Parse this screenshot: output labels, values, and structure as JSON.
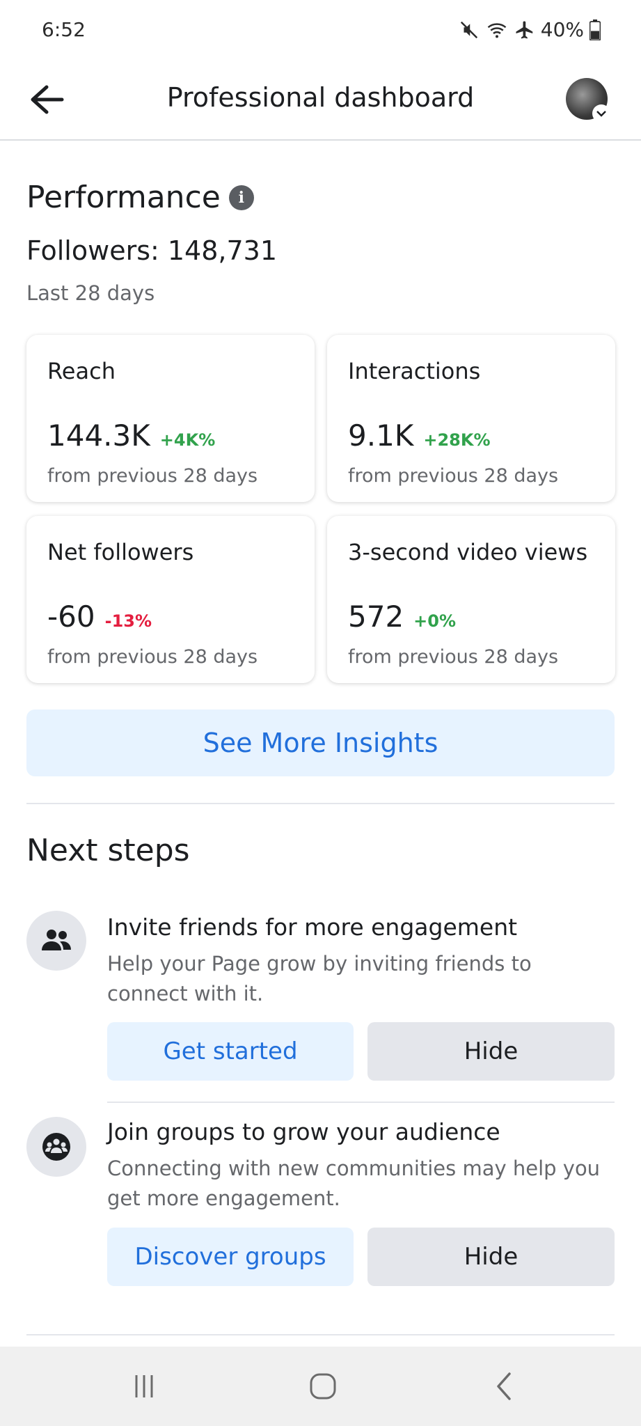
{
  "status_bar": {
    "time": "6:52",
    "battery": "40%"
  },
  "header": {
    "title": "Professional dashboard"
  },
  "performance": {
    "title": "Performance",
    "followers": "Followers: 148,731",
    "period": "Last 28 days",
    "cards": [
      {
        "label": "Reach",
        "value": "144.3K",
        "delta": "+4K%",
        "trend": "up",
        "sub": "from previous 28 days"
      },
      {
        "label": "Interactions",
        "value": "9.1K",
        "delta": "+28K%",
        "trend": "up",
        "sub": "from previous 28 days"
      },
      {
        "label": "Net followers",
        "value": "-60",
        "delta": "-13%",
        "trend": "down",
        "sub": "from previous 28 days"
      },
      {
        "label": "3-second video views",
        "value": "572",
        "delta": "+0%",
        "trend": "up",
        "sub": "from previous 28 days"
      }
    ],
    "insights_button": "See More Insights"
  },
  "next_steps": {
    "title": "Next steps",
    "items": [
      {
        "icon": "people-icon",
        "title": "Invite friends for more engagement",
        "description": "Help your Page grow by inviting friends to connect with it.",
        "primary": "Get started",
        "secondary": "Hide"
      },
      {
        "icon": "groups-icon",
        "title": "Join groups to grow your audience",
        "description": "Connecting with new communities may help you get more engagement.",
        "primary": "Discover groups",
        "secondary": "Hide"
      }
    ]
  },
  "colors": {
    "accent": "#216fdb",
    "accent_bg": "#e7f3ff",
    "positive": "#31a24c",
    "negative": "#e41e3f"
  }
}
